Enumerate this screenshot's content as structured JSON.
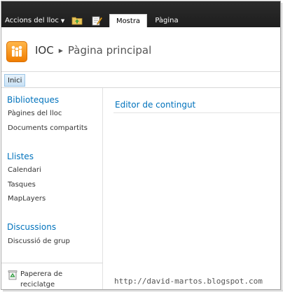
{
  "ribbon": {
    "site_actions_label": "Accions del lloc",
    "tabs": [
      {
        "label": "Mostra",
        "selected": true
      },
      {
        "label": "Pàgina",
        "selected": false
      }
    ]
  },
  "header": {
    "site_title": "IOC",
    "page_title": "Pàgina principal"
  },
  "topnav": {
    "items": [
      {
        "label": "Inici",
        "selected": true
      }
    ]
  },
  "quicklaunch": {
    "sections": [
      {
        "heading": "Biblioteques",
        "items": [
          "Pàgines del lloc",
          "Documents compartits"
        ]
      },
      {
        "heading": "Llistes",
        "items": [
          "Calendari",
          "Tasques",
          "MapLayers"
        ]
      },
      {
        "heading": "Discussions",
        "items": [
          "Discussió de grup"
        ]
      }
    ],
    "recycle_bin": "Paperera de reciclatge"
  },
  "main": {
    "webpart_title": "Editor de contingut"
  },
  "watermark": "http://david-martos.blogspot.com",
  "colors": {
    "accent_link": "#0072bc",
    "ribbon_bg": "#2b2b2b",
    "logo_orange": "#f07d00"
  }
}
